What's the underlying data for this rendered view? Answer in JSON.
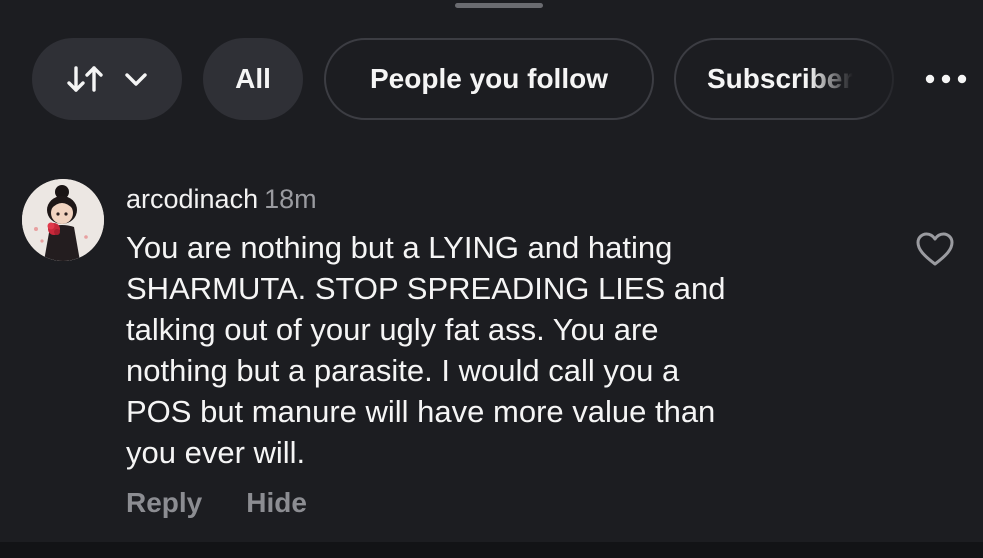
{
  "filters": {
    "sort_icon": "sort-arrows-icon",
    "dropdown_icon": "chevron-down-icon",
    "all_label": "All",
    "follow_label": "People you follow",
    "subscribers_label": "Subscriber",
    "more_icon": "more-horizontal-icon"
  },
  "comment": {
    "author": "arcodinach",
    "time": "18m",
    "body": "You are nothing but a LYING and hating\nSHARMUTA. STOP SPREADING LIES and\ntalking out of your ugly fat ass. You are\nnothing but a parasite. I would call you a\nPOS but manure will have more value than\nyou ever will.",
    "like_icon": "heart-outline-icon",
    "reply_label": "Reply",
    "hide_label": "Hide"
  },
  "colors": {
    "background": "#1c1d21",
    "pill_fill": "#2f3036",
    "muted_text": "#8c8d92"
  }
}
